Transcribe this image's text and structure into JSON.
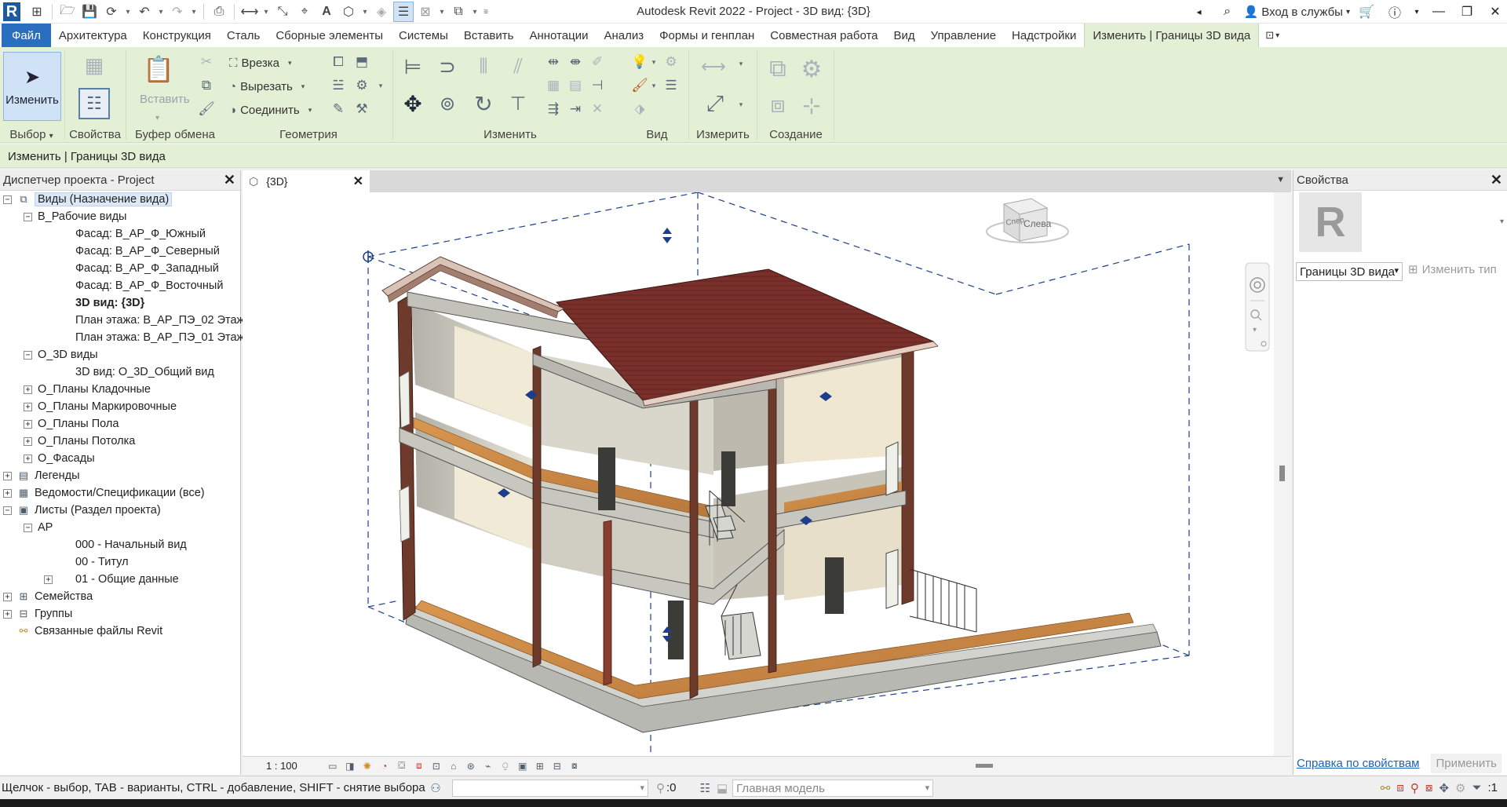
{
  "app": {
    "title": "Autodesk Revit 2022 - Project - 3D вид: {3D}",
    "signin": "Вход в службы"
  },
  "tabs": [
    "Файл",
    "Архитектура",
    "Конструкция",
    "Сталь",
    "Сборные элементы",
    "Системы",
    "Вставить",
    "Аннотации",
    "Анализ",
    "Формы и генплан",
    "Совместная работа",
    "Вид",
    "Управление",
    "Надстройки",
    "Изменить | Границы 3D вида"
  ],
  "ribbon": {
    "modify_button": "Изменить",
    "paste_button": "Вставить",
    "cope_button": "Врезка",
    "cut_button": "Вырезать",
    "join_button": "Соединить",
    "panels": {
      "select": "Выбор",
      "properties": "Свойства",
      "clipboard": "Буфер обмена",
      "geometry": "Геометрия",
      "modify": "Изменить",
      "view": "Вид",
      "measure": "Измерить",
      "create": "Создание"
    }
  },
  "options_bar": {
    "context": "Изменить | Границы 3D вида"
  },
  "project_browser": {
    "title": "Диспетчер проекта - Project",
    "items": [
      {
        "label": "Виды (Назначение вида)",
        "toggle": "−",
        "icon": "views-icon",
        "level": 0,
        "selected": true
      },
      {
        "label": "В_Рабочие виды",
        "toggle": "−",
        "level": 1
      },
      {
        "label": "Фасад: В_АР_Ф_Южный",
        "level": 2
      },
      {
        "label": "Фасад: В_АР_Ф_Северный",
        "level": 2
      },
      {
        "label": "Фасад: В_АР_Ф_Западный",
        "level": 2
      },
      {
        "label": "Фасад: В_АР_Ф_Восточный",
        "level": 2
      },
      {
        "label": "3D вид: {3D}",
        "level": 2,
        "bold": true
      },
      {
        "label": "План этажа: В_АР_ПЭ_02 Этаж",
        "level": 2
      },
      {
        "label": "План этажа: В_АР_ПЭ_01 Этаж",
        "level": 2
      },
      {
        "label": "О_3D виды",
        "toggle": "−",
        "level": 1
      },
      {
        "label": "3D вид: О_3D_Общий вид",
        "level": 2
      },
      {
        "label": "О_Планы Кладочные",
        "toggle": "+",
        "level": 1
      },
      {
        "label": "О_Планы Маркировочные",
        "toggle": "+",
        "level": 1
      },
      {
        "label": "О_Планы Пола",
        "toggle": "+",
        "level": 1
      },
      {
        "label": "О_Планы Потолка",
        "toggle": "+",
        "level": 1
      },
      {
        "label": "О_Фасады",
        "toggle": "+",
        "level": 1
      },
      {
        "label": "Легенды",
        "toggle": "+",
        "icon": "legend-icon",
        "level": 0
      },
      {
        "label": "Ведомости/Спецификации (все)",
        "toggle": "+",
        "icon": "schedule-icon",
        "level": 0
      },
      {
        "label": "Листы (Раздел проекта)",
        "toggle": "−",
        "icon": "sheets-icon",
        "level": 0
      },
      {
        "label": "АР",
        "toggle": "−",
        "level": 1
      },
      {
        "label": "000 - Начальный вид",
        "level": 2
      },
      {
        "label": "00 - Титул",
        "level": 2
      },
      {
        "label": "01 - Общие данные",
        "toggle": "+",
        "level": 2
      },
      {
        "label": "Семейства",
        "toggle": "+",
        "icon": "families-icon",
        "level": 0
      },
      {
        "label": "Группы",
        "toggle": "+",
        "icon": "groups-icon",
        "level": 0
      },
      {
        "label": "Связанные файлы Revit",
        "icon": "links-icon",
        "level": 0
      }
    ]
  },
  "view": {
    "tab_label": "{3D}",
    "scale": "1 : 100",
    "viewcube_left": "Слева",
    "viewcube_front": "Спер"
  },
  "properties": {
    "title": "Свойства",
    "type_selector": "Границы 3D вида",
    "edit_type": "Изменить тип",
    "help_link": "Справка по свойствам",
    "apply_button": "Применить"
  },
  "status": {
    "hint": "Щелчок - выбор, TAB - варианты, CTRL - добавление, SHIFT - снятие выбора.",
    "coord": ":0",
    "model": "Главная модель",
    "filter_count": ":1"
  },
  "colors": {
    "ribbon_context": "#e4f0d5",
    "file_tab": "#2a6fbf",
    "roof": "#7a2f2a",
    "floor": "#c98a4a",
    "wall_interior": "#f4ecd8",
    "section_cut": "#c7c7bf"
  }
}
